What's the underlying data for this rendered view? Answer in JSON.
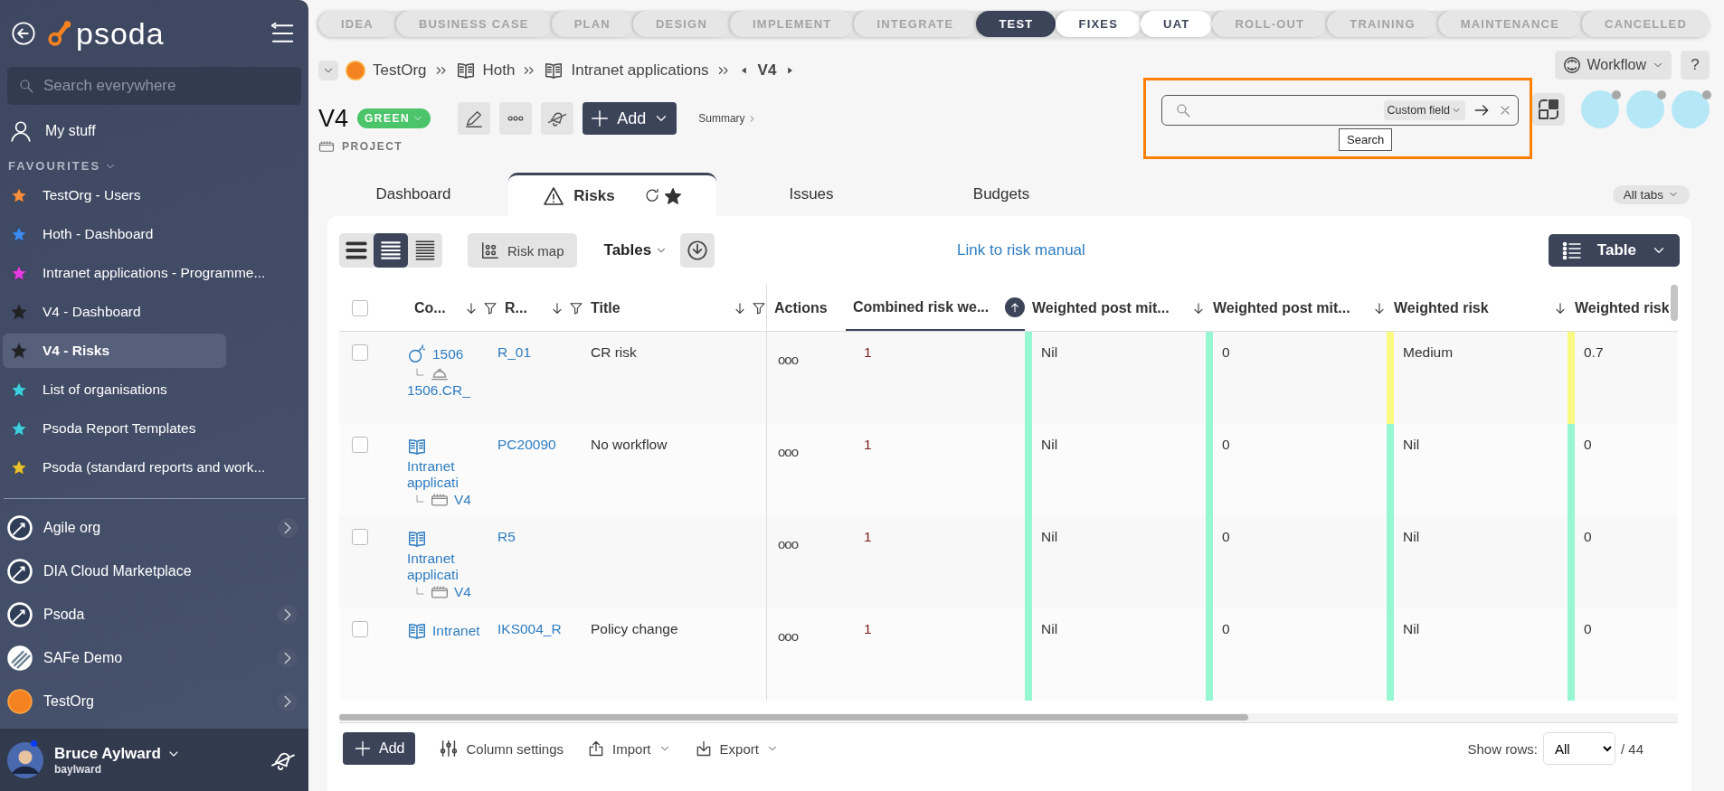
{
  "sidebar": {
    "logo": "psoda",
    "search": {
      "placeholder": "Search everywhere"
    },
    "my_stuff": "My stuff",
    "favourites_heading": "FAVOURITES",
    "favourites": [
      {
        "label": "TestOrg - Users",
        "color": "#f78f3f",
        "selected": false
      },
      {
        "label": "Hoth - Dashboard",
        "color": "#3d8bf0",
        "selected": false
      },
      {
        "label": "Intranet applications - Programme...",
        "color": "#e63be0",
        "selected": false
      },
      {
        "label": "V4 - Dashboard",
        "color": "#222222",
        "selected": false
      },
      {
        "label": "V4 - Risks",
        "color": "#222222",
        "selected": true
      },
      {
        "label": "List of organisations",
        "color": "#3ccfe0",
        "selected": false
      },
      {
        "label": "Psoda Report Templates",
        "color": "#3ccfe0",
        "selected": false
      },
      {
        "label": "Psoda (standard reports and work...",
        "color": "#e8c12e",
        "selected": false
      }
    ],
    "organisations": [
      {
        "label": "Agile org",
        "kind": "rocket",
        "expandable": true
      },
      {
        "label": "DIA Cloud Marketplace",
        "kind": "rocket",
        "expandable": false
      },
      {
        "label": "Psoda",
        "kind": "rocket",
        "expandable": true
      },
      {
        "label": "SAFe Demo",
        "kind": "stripes",
        "expandable": true
      },
      {
        "label": "TestOrg",
        "kind": "orange",
        "expandable": true
      }
    ],
    "user": {
      "name": "Bruce Aylward",
      "username": "baylward"
    }
  },
  "stages": [
    {
      "label": "IDEA",
      "selected": false,
      "available": false
    },
    {
      "label": "BUSINESS CASE",
      "selected": false,
      "available": false
    },
    {
      "label": "PLAN",
      "selected": false,
      "available": false
    },
    {
      "label": "DESIGN",
      "selected": false,
      "available": false
    },
    {
      "label": "IMPLEMENT",
      "selected": false,
      "available": false
    },
    {
      "label": "INTEGRATE",
      "selected": false,
      "available": false
    },
    {
      "label": "TEST",
      "selected": true,
      "available": false
    },
    {
      "label": "FIXES",
      "selected": false,
      "available": true
    },
    {
      "label": "UAT",
      "selected": false,
      "available": true
    },
    {
      "label": "ROLL-OUT",
      "selected": false,
      "available": false
    },
    {
      "label": "TRAINING",
      "selected": false,
      "available": false
    },
    {
      "label": "MAINTENANCE",
      "selected": false,
      "available": false
    },
    {
      "label": "CANCELLED",
      "selected": false,
      "available": false
    }
  ],
  "breadcrumb": [
    {
      "label": "TestOrg",
      "kind": "org"
    },
    {
      "label": "Hoth",
      "kind": "book"
    },
    {
      "label": "Intranet applications",
      "kind": "book"
    }
  ],
  "current_item": "V4",
  "project": {
    "title": "V4",
    "status": "GREEN",
    "color": "#4cc46a",
    "type": "PROJECT"
  },
  "add_button": "Add",
  "summary_link": "Summary",
  "workflow_button": "Workflow",
  "help_button": "?",
  "search": {
    "scope": "Custom field",
    "tooltip": "Search"
  },
  "tabs": [
    {
      "label": "Dashboard",
      "selected": false
    },
    {
      "label": "Risks",
      "selected": true
    },
    {
      "label": "Issues",
      "selected": false
    },
    {
      "label": "Budgets",
      "selected": false
    }
  ],
  "all_tabs": "All tabs",
  "toolbar": {
    "density": [
      {
        "selected": false
      },
      {
        "selected": true
      },
      {
        "selected": false
      }
    ],
    "risk_map": "Risk map",
    "tables": "Tables",
    "link": "Link to risk manual",
    "view": "Table"
  },
  "table": {
    "all_selected": false,
    "columns": [
      {
        "label": "Co...",
        "sortable": true,
        "filter": true,
        "sorted": false
      },
      {
        "label": "R...",
        "sortable": true,
        "filter": true,
        "sorted": false
      },
      {
        "label": "Title",
        "sortable": true,
        "filter": true,
        "sorted": false
      },
      {
        "label": "Actions",
        "sortable": false,
        "filter": false,
        "sorted": false
      },
      {
        "label": "Combined risk we...",
        "sortable": true,
        "filter": false,
        "sorted": true
      },
      {
        "label": "Weighted post mit...",
        "sortable": true,
        "filter": false,
        "sorted": false
      },
      {
        "label": "Weighted post mit...",
        "sortable": true,
        "filter": false,
        "sorted": false
      },
      {
        "label": "Weighted risk",
        "sortable": true,
        "filter": false,
        "sorted": false
      },
      {
        "label": "Weighted risk"
      }
    ],
    "rows": [
      {
        "selected": false,
        "code": {
          "kind": "change",
          "text": "1506",
          "child": {
            "kind": "bell",
            "text": "1506.CR_"
          }
        },
        "ref": "R_01",
        "title": "CR risk",
        "actions": "ooo",
        "combined": "1",
        "weighted": [
          {
            "text": "Nil",
            "color": "#98f7d3"
          },
          {
            "text": "0",
            "color": "#98f7d3"
          },
          {
            "text": "Medium",
            "color": "#fafa82"
          },
          {
            "text": "0.7",
            "color": "#fafa82"
          }
        ]
      },
      {
        "selected": false,
        "code": {
          "kind": "programme",
          "text": "Intranet applicati",
          "child": {
            "kind": "project",
            "text": "V4"
          }
        },
        "ref": "PC20090",
        "title": "No workflow",
        "actions": "ooo",
        "combined": "1",
        "weighted": [
          {
            "text": "Nil",
            "color": "#98f7d3"
          },
          {
            "text": "0",
            "color": "#98f7d3"
          },
          {
            "text": "Nil",
            "color": "#98f7d3"
          },
          {
            "text": "0",
            "color": "#98f7d3"
          }
        ]
      },
      {
        "selected": false,
        "code": {
          "kind": "programme",
          "text": "Intranet applicati",
          "child": {
            "kind": "project",
            "text": "V4"
          }
        },
        "ref": "R5",
        "actions": "ooo",
        "combined": "1",
        "weighted": [
          {
            "text": "Nil",
            "color": "#98f7d3"
          },
          {
            "text": "0",
            "color": "#98f7d3"
          },
          {
            "text": "Nil",
            "color": "#98f7d3"
          },
          {
            "text": "0",
            "color": "#98f7d3"
          }
        ]
      },
      {
        "selected": false,
        "code": {
          "kind": "programme",
          "text": "Intranet"
        },
        "ref": "IKS004_R",
        "title": "Policy change",
        "actions": "ooo",
        "combined": "1",
        "weighted": [
          {
            "text": "Nil",
            "color": "#98f7d3"
          },
          {
            "text": "0",
            "color": "#98f7d3"
          },
          {
            "text": "Nil",
            "color": "#98f7d3"
          },
          {
            "text": "0",
            "color": "#98f7d3"
          }
        ]
      }
    ]
  },
  "footer": {
    "add": "Add",
    "column_settings": "Column settings",
    "import": "Import",
    "export": "Export",
    "show_rows_label": "Show rows:",
    "show_rows": "All",
    "total": "/ 44"
  }
}
